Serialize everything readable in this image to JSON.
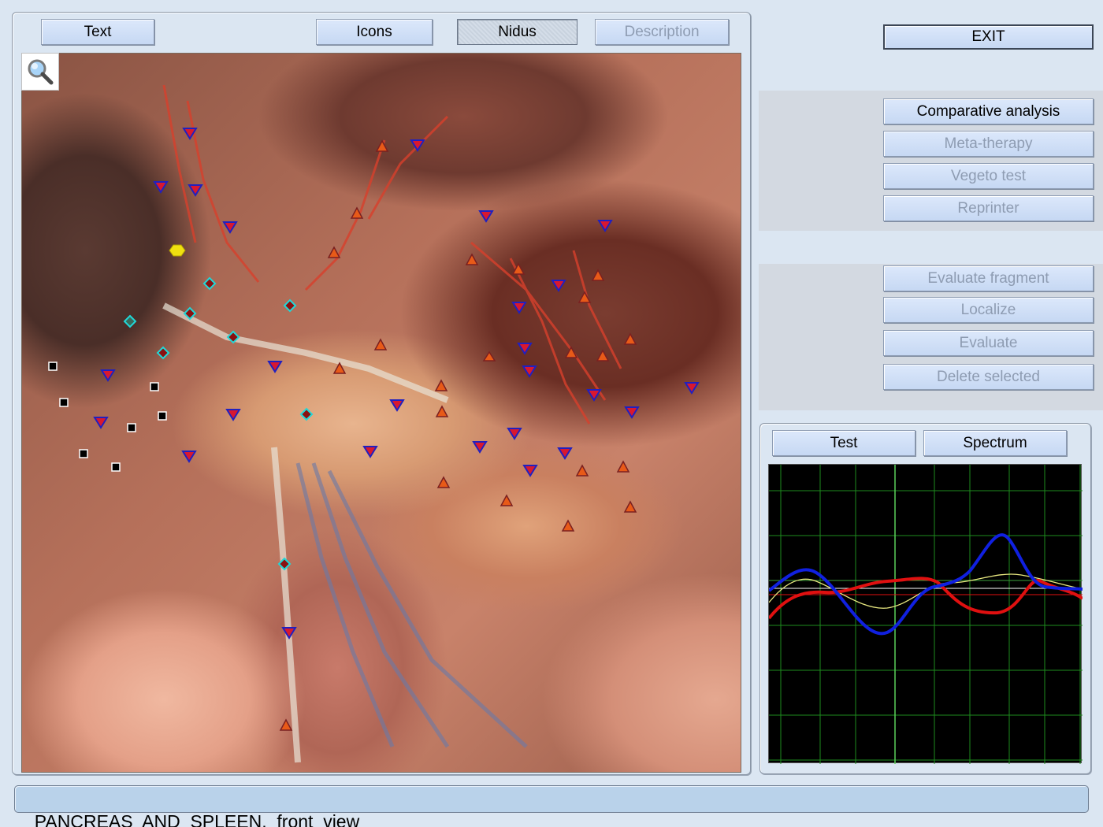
{
  "tabs": {
    "text": "Text",
    "icons": "Icons",
    "nidus": "Nidus",
    "description": "Description"
  },
  "exit_label": "EXIT",
  "analysis_buttons": {
    "comparative": "Comparative analysis",
    "meta_therapy": "Meta-therapy",
    "vegeto_test": "Vegeto test",
    "reprinter": "Reprinter"
  },
  "fragment_buttons": {
    "evaluate_fragment": "Evaluate fragment",
    "localize": "Localize",
    "evaluate": "Evaluate",
    "delete_selected": "Delete selected"
  },
  "graph_tabs": {
    "test": "Test",
    "spectrum": "Spectrum"
  },
  "status_text": "PANCREAS  AND  SPLEEN,  front  view",
  "viewer": {
    "zoom_icon": "magnifier-icon",
    "marker_colors": {
      "down_triangle_fill": "#d81830",
      "down_triangle_stroke": "#2020c0",
      "up_triangle_fill": "#e85a18",
      "up_triangle_stroke": "#7a2020",
      "diamond_fill": "#8a1010",
      "diamond_stroke": "#20d8d8",
      "square": "#000000",
      "hexagon": "#f0e010"
    }
  },
  "graph": {
    "background": "#000000",
    "grid_color": "#1e8c1e",
    "series_colors": [
      "#1020e0",
      "#e01010",
      "#e8e880"
    ]
  }
}
